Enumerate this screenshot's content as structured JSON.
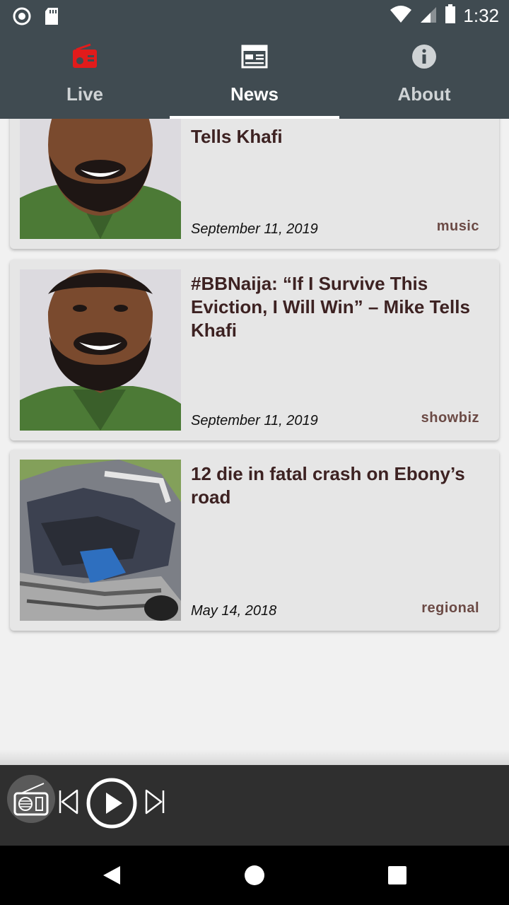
{
  "status_bar": {
    "time": "1:32",
    "icons": [
      "record-icon",
      "sd-card-icon",
      "wifi-icon",
      "signal-icon",
      "battery-icon"
    ]
  },
  "tabs": [
    {
      "label": "Live",
      "icon": "radio-icon",
      "icon_color": "#e21b1b",
      "active": false
    },
    {
      "label": "News",
      "icon": "newspaper-icon",
      "active": true
    },
    {
      "label": "About",
      "icon": "info-icon",
      "active": false
    }
  ],
  "news": [
    {
      "title": "Tells Khafi",
      "date": "September 11, 2019",
      "category": "music",
      "image": "man-portrait"
    },
    {
      "title": "#BBNaija: “If I Survive This Eviction, I Will Win” – Mike Tells Khafi",
      "date": "September 11, 2019",
      "category": "showbiz",
      "image": "man-portrait"
    },
    {
      "title": "12 die in fatal crash on Ebony’s road",
      "date": "May 14, 2018",
      "category": "regional",
      "image": "crash-wreckage"
    }
  ],
  "player": {
    "icons": [
      "radio-icon",
      "skip-previous-icon",
      "play-icon",
      "skip-next-icon"
    ]
  },
  "nav": {
    "icons": [
      "back-icon",
      "home-icon",
      "recents-icon"
    ]
  },
  "colors": {
    "header_bg": "#404b51",
    "card_bg": "#e6e6e6",
    "title_color": "#3d2222",
    "tag_color": "#6b4a45",
    "live_accent": "#e21b1b"
  }
}
